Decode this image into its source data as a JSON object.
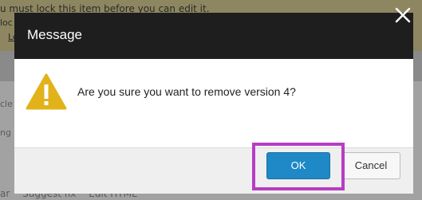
{
  "background": {
    "notice_line1": "u must lock this item before you can edit it.",
    "notice_line2": "loc",
    "notice_link": "Lo",
    "side_text1": "cle",
    "side_text2": "ng",
    "bottom_links": [
      "ar",
      "Suggest fix",
      "Edit HTML"
    ]
  },
  "dialog": {
    "title": "Message",
    "message": "Are you sure you want to remove version 4?",
    "ok_label": "OK",
    "cancel_label": "Cancel"
  },
  "colors": {
    "header": "#1e1e1e",
    "ok_button": "#1f88c6",
    "warning": "#e2b21a",
    "highlight": "#b83cc3"
  },
  "icons": {
    "close": "close-icon",
    "warning": "warning-icon"
  }
}
